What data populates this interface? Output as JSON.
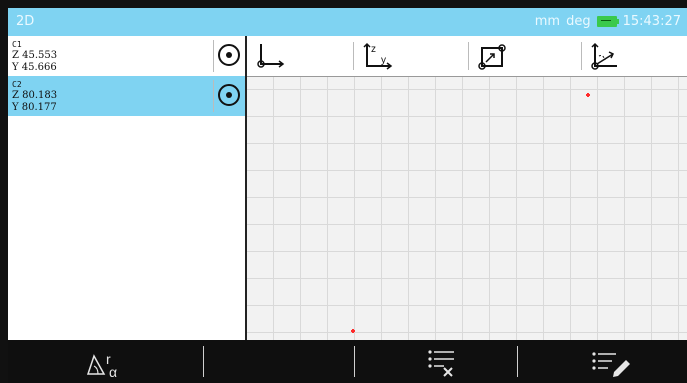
{
  "title": "2D",
  "status": {
    "units": "mm",
    "angle_units": "deg",
    "time": "15:43:27",
    "battery_color": "#3ac94c"
  },
  "list": [
    {
      "id": "C1",
      "z": "Z 45.553",
      "y": "Y 45.666",
      "selected": false
    },
    {
      "id": "C2",
      "z": "Z 80.183",
      "y": "Y 80.177",
      "selected": true
    }
  ],
  "canvas": {
    "axis_buttons": [
      {
        "icon": "origin-axes-icon"
      },
      {
        "icon": "axis-zy-icon",
        "label_z": "z",
        "label_y": "y"
      },
      {
        "icon": "frame-origin-icon"
      },
      {
        "icon": "axis-rotate-icon"
      }
    ],
    "points": [
      {
        "color": "#ff2b2b",
        "z": 80.183,
        "y": 80.177
      },
      {
        "color": "#ff2b2b",
        "z": 45.553,
        "y": 45.666
      }
    ]
  },
  "bottom": {
    "buttons": [
      {
        "name": "polar-button",
        "label": "r",
        "sub": "α"
      },
      {
        "name": "list-delete-button"
      },
      {
        "name": "list-edit-button"
      }
    ]
  },
  "colors": {
    "titlebar": "#7fd3f2",
    "selection": "#7fd3f2",
    "point": "#ff2b2b"
  }
}
